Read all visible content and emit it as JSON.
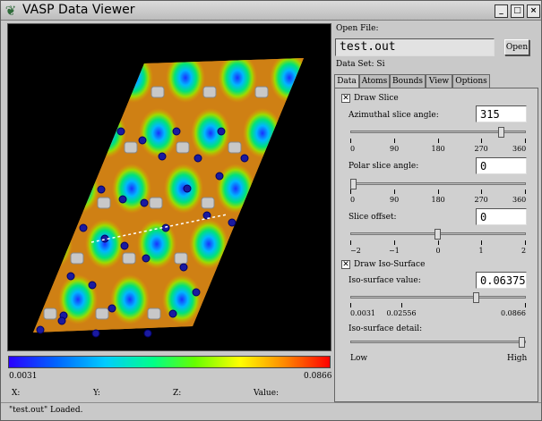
{
  "window": {
    "title": "VASP Data Viewer",
    "controls": {
      "minimize": "_",
      "maximize": "□",
      "close": "×"
    }
  },
  "open_file": {
    "label": "Open File:",
    "value": "test.out",
    "button": "Open"
  },
  "dataset": {
    "label": "Data Set: Si"
  },
  "tabs": [
    "Data",
    "Atoms",
    "Bounds",
    "View",
    "Options"
  ],
  "active_tab": "Data",
  "draw_slice": {
    "label": "Draw Slice",
    "checked": true
  },
  "azimuthal": {
    "label": "Azimuthal slice angle:",
    "value": "315",
    "ticks": [
      "0",
      "90",
      "180",
      "270",
      "360"
    ],
    "min": 0,
    "max": 360,
    "current": 315
  },
  "polar": {
    "label": "Polar slice angle:",
    "value": "0",
    "ticks": [
      "0",
      "90",
      "180",
      "270",
      "360"
    ],
    "min": 0,
    "max": 360,
    "current": 0
  },
  "offset": {
    "label": "Slice offset:",
    "value": "0",
    "ticks": [
      "−2",
      "−1",
      "0",
      "1",
      "2"
    ],
    "min": -2.5,
    "max": 2.5,
    "current": 0
  },
  "draw_iso": {
    "label": "Draw Iso-Surface",
    "checked": true
  },
  "iso_value": {
    "label": "Iso-surface value:",
    "value": "0.06375",
    "ticks": [
      "0.0031",
      "0.02556",
      "0.0866"
    ],
    "min": 0.0031,
    "max": 0.0866,
    "current": 0.06375
  },
  "iso_detail": {
    "label": "Iso-surface detail:",
    "low": "Low",
    "high": "High",
    "current": 1.0
  },
  "colorbar": {
    "min_label": "0.0031",
    "max_label": "0.0866"
  },
  "coords": {
    "x": "X:",
    "y": "Y:",
    "z": "Z:",
    "value": "Value:"
  },
  "status": "\"test.out\" Loaded."
}
